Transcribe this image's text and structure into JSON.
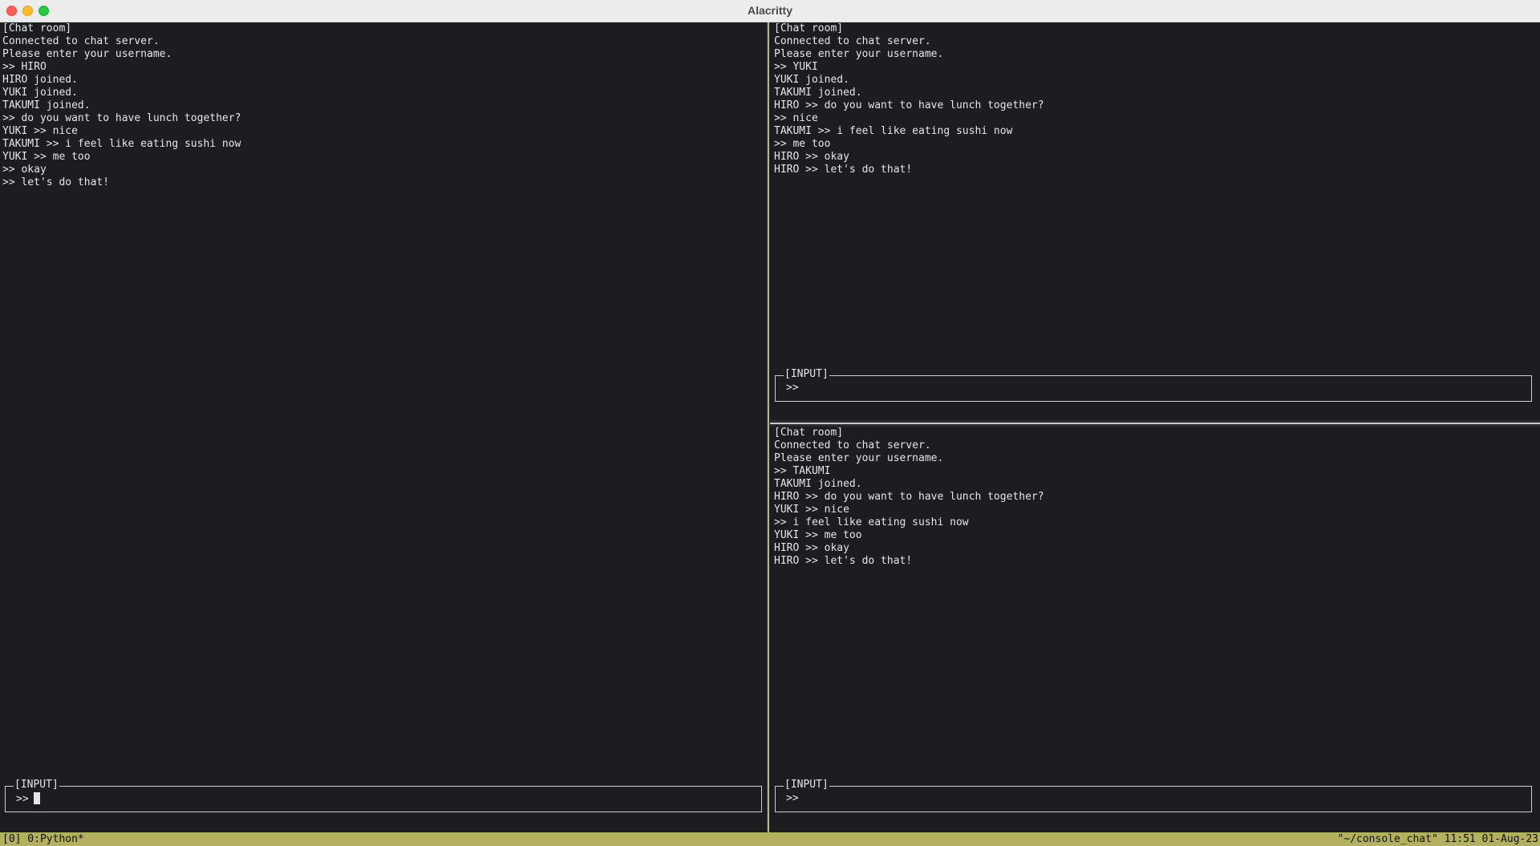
{
  "window": {
    "title": "Alacritty"
  },
  "panes": {
    "left": {
      "lines": [
        "[Chat room]",
        "Connected to chat server.",
        "Please enter your username.",
        ">> HIRO",
        "HIRO joined.",
        "YUKI joined.",
        "TAKUMI joined.",
        ">> do you want to have lunch together?",
        "YUKI >> nice",
        "TAKUMI >> i feel like eating sushi now",
        "YUKI >> me too",
        ">> okay",
        ">> let's do that!"
      ],
      "input": {
        "legend": "[INPUT]",
        "prompt": ">>"
      }
    },
    "top_right": {
      "lines": [
        "[Chat room]",
        "Connected to chat server.",
        "Please enter your username.",
        ">> YUKI",
        "YUKI joined.",
        "TAKUMI joined.",
        "HIRO >> do you want to have lunch together?",
        ">> nice",
        "TAKUMI >> i feel like eating sushi now",
        ">> me too",
        "HIRO >> okay",
        "HIRO >> let's do that!"
      ],
      "input": {
        "legend": "[INPUT]",
        "prompt": ">>"
      }
    },
    "bottom_right": {
      "lines": [
        "[Chat room]",
        "Connected to chat server.",
        "Please enter your username.",
        ">> TAKUMI",
        "TAKUMI joined.",
        "HIRO >> do you want to have lunch together?",
        "YUKI >> nice",
        ">> i feel like eating sushi now",
        "YUKI >> me too",
        "HIRO >> okay",
        "HIRO >> let's do that!"
      ],
      "input": {
        "legend": "[INPUT]",
        "prompt": ">>"
      }
    }
  },
  "statusbar": {
    "left": "[0] 0:Python*",
    "right": "\"~/console_chat\" 11:51 01-Aug-23"
  },
  "colors": {
    "terminal_bg": "#1c1d20",
    "text": "#e6e6e6",
    "status_bg": "#b3b05f"
  }
}
